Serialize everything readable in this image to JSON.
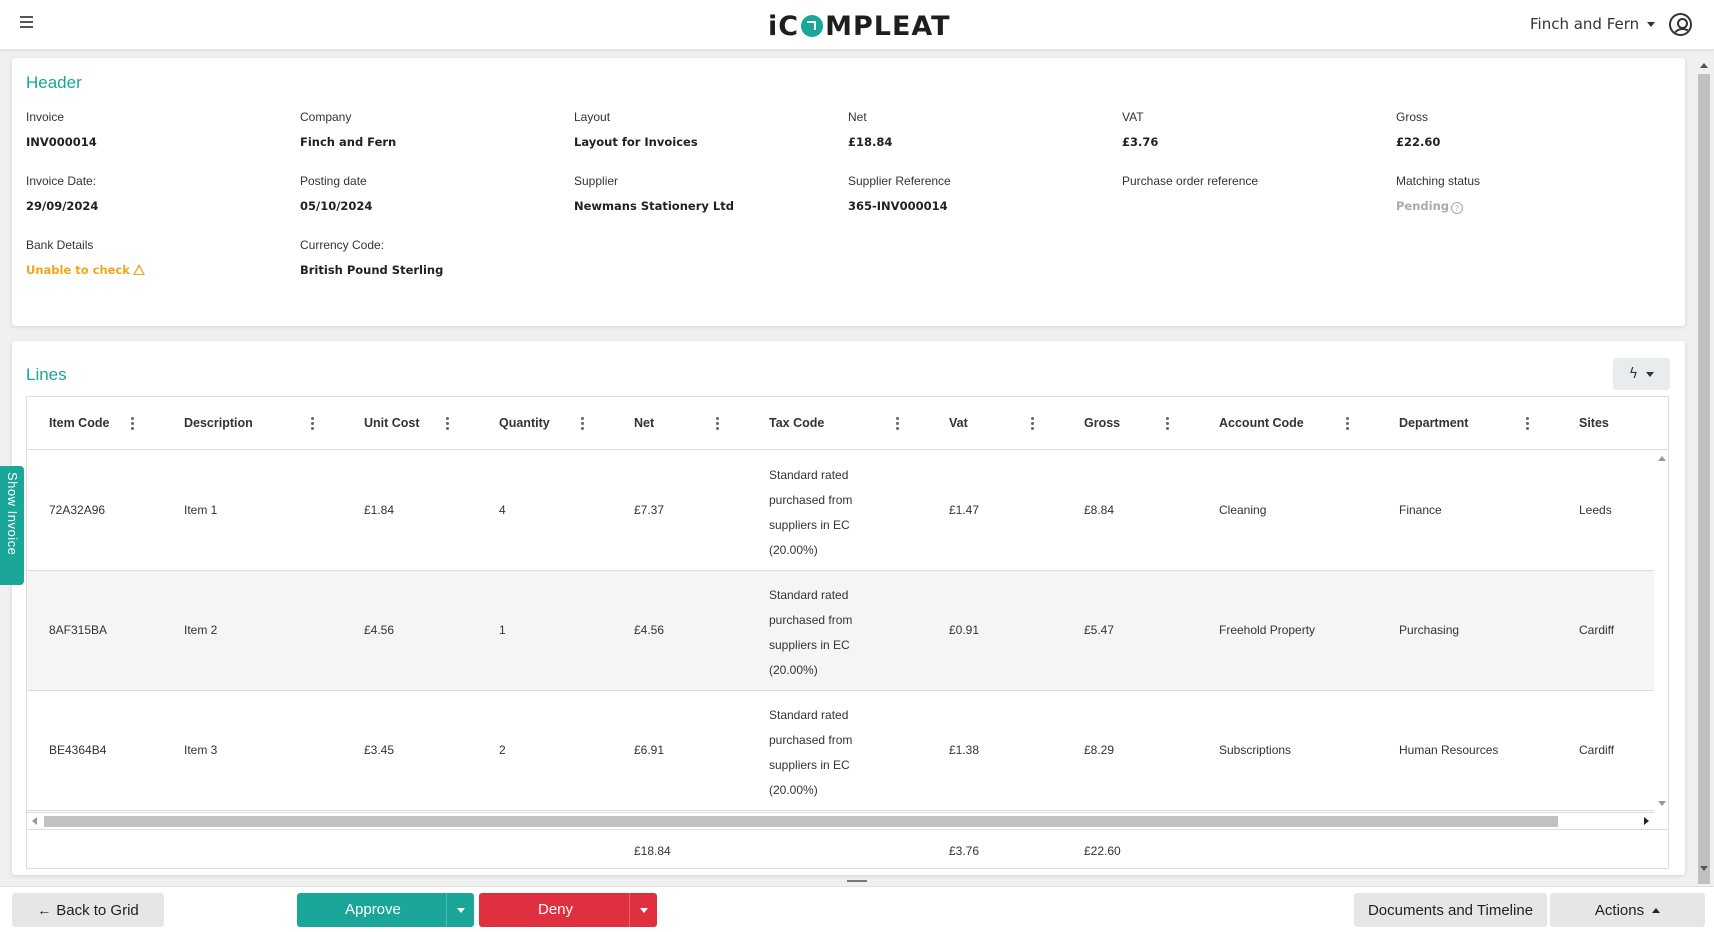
{
  "app": {
    "logo": "iCOMPLEAT",
    "company": "Finch and Fern"
  },
  "header_card": {
    "title": "Header",
    "fields": [
      {
        "label": "Invoice",
        "value": "INV000014"
      },
      {
        "label": "Company",
        "value": "Finch and Fern"
      },
      {
        "label": "Layout",
        "value": "Layout for Invoices"
      },
      {
        "label": "Net",
        "value": "£18.84"
      },
      {
        "label": "VAT",
        "value": "£3.76"
      },
      {
        "label": "Gross",
        "value": "£22.60"
      },
      {
        "label": "Invoice Date:",
        "value": "29/09/2024"
      },
      {
        "label": "Posting date",
        "value": "05/10/2024"
      },
      {
        "label": "Supplier",
        "value": "Newmans Stationery Ltd"
      },
      {
        "label": "Supplier Reference",
        "value": "365-INV000014"
      },
      {
        "label": "Purchase order reference",
        "value": ""
      },
      {
        "label": "Matching status",
        "value": "Pending"
      },
      {
        "label": "Bank Details",
        "value": "Unable to check"
      },
      {
        "label": "Currency Code:",
        "value": "British Pound Sterling"
      }
    ]
  },
  "lines_card": {
    "title": "Lines",
    "columns": [
      "Item Code",
      "Description",
      "Unit Cost",
      "Quantity",
      "Net",
      "Tax Code",
      "Vat",
      "Gross",
      "Account Code",
      "Department",
      "Sites"
    ],
    "rows": [
      {
        "item_code": "72A32A96",
        "description": "Item 1",
        "unit_cost": "£1.84",
        "quantity": "4",
        "net": "£7.37",
        "tax_code": [
          "Standard rated",
          "purchased from",
          "suppliers in EC",
          "(20.00%)"
        ],
        "vat": "£1.47",
        "gross": "£8.84",
        "account_code": "Cleaning",
        "department": "Finance",
        "sites": "Leeds"
      },
      {
        "item_code": "8AF315BA",
        "description": "Item 2",
        "unit_cost": "£4.56",
        "quantity": "1",
        "net": "£4.56",
        "tax_code": [
          "Standard rated",
          "purchased from",
          "suppliers in EC",
          "(20.00%)"
        ],
        "vat": "£0.91",
        "gross": "£5.47",
        "account_code": "Freehold Property",
        "department": "Purchasing",
        "sites": "Cardiff"
      },
      {
        "item_code": "BE4364B4",
        "description": "Item 3",
        "unit_cost": "£3.45",
        "quantity": "2",
        "net": "£6.91",
        "tax_code": [
          "Standard rated",
          "purchased from",
          "suppliers in EC",
          "(20.00%)"
        ],
        "vat": "£1.38",
        "gross": "£8.29",
        "account_code": "Subscriptions",
        "department": "Human Resources",
        "sites": "Cardiff"
      }
    ],
    "totals": {
      "net": "£18.84",
      "vat": "£3.76",
      "gross": "£22.60"
    }
  },
  "side_tab": {
    "label": "Show Invoice"
  },
  "bottom_bar": {
    "back": "Back to Grid",
    "approve": "Approve",
    "deny": "Deny",
    "documents": "Documents and Timeline",
    "actions": "Actions"
  },
  "colors": {
    "accent": "#1aa698",
    "deny": "#e0303f",
    "warning": "#f2a516"
  }
}
